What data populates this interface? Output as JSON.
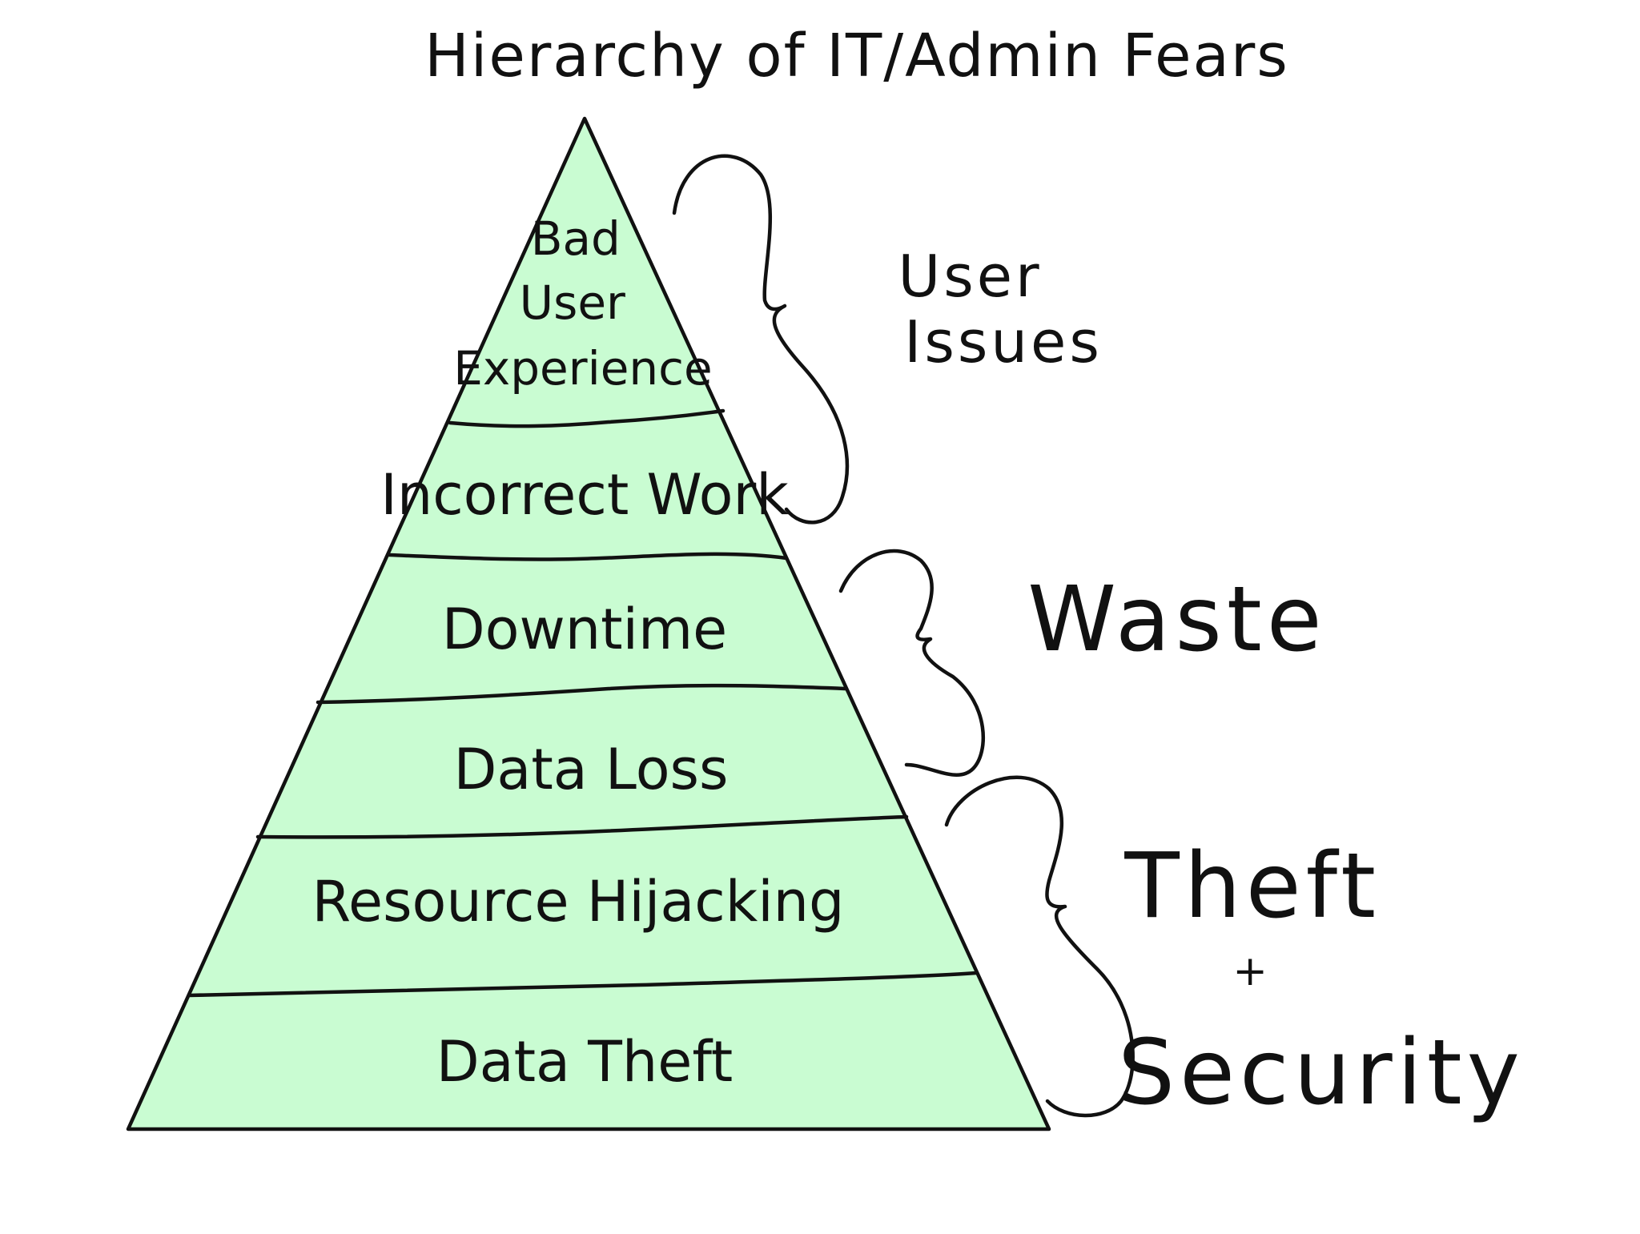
{
  "title": "Hierarchy of IT/Admin Fears",
  "colors": {
    "pyramid_fill": "#c9fcd2",
    "ink": "#111111",
    "background": "#ffffff"
  },
  "tiers": [
    {
      "lines": [
        "Bad",
        "User",
        "Experience"
      ]
    },
    {
      "lines": [
        "Incorrect Work"
      ]
    },
    {
      "lines": [
        "Downtime"
      ]
    },
    {
      "lines": [
        "Data Loss"
      ]
    },
    {
      "lines": [
        "Resource Hijacking"
      ]
    },
    {
      "lines": [
        "Data Theft"
      ]
    }
  ],
  "groups": [
    {
      "lines": [
        "User",
        "Issues"
      ]
    },
    {
      "lines": [
        "Waste"
      ]
    },
    {
      "lines": [
        "Theft",
        "+",
        "Security"
      ]
    }
  ]
}
